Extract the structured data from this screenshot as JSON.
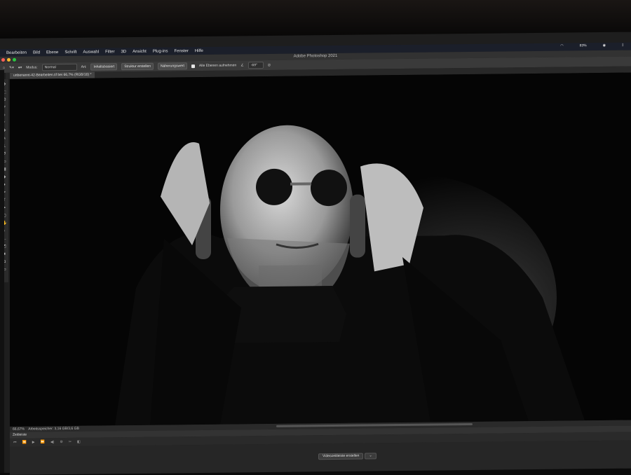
{
  "menubar": {
    "items": [
      "Bearbeiten",
      "Bild",
      "Ebene",
      "Schrift",
      "Auswahl",
      "Filter",
      "3D",
      "Ansicht",
      "Plug-ins",
      "Fenster",
      "Hilfe"
    ],
    "battery": "83%"
  },
  "window": {
    "title": "Adobe Photoshop 2021"
  },
  "options_bar": {
    "mode_label": "Modus:",
    "mode_value": "Normal",
    "type_label": "Art:",
    "btn_content_aware": "Inhaltsbasiert",
    "btn_create_texture": "Struktur erstellen",
    "btn_proximity": "Näherungswert",
    "sample_all_layers": "Alle Ebenen aufnehmen",
    "angle_value": "-69°"
  },
  "document": {
    "tab_title": "unbenannt-42-Bearbeiten.tif bei 66,7% (RGB/16) *"
  },
  "status": {
    "zoom": "66,67%",
    "scratch": "Arbeitsspeicher: 3,16 GB/3,6 GB"
  },
  "timeline": {
    "title": "Zeitleiste",
    "create_button": "Videozeitleiste erstellen"
  },
  "colors": {
    "accent": "#1b1f2a",
    "panel": "#2b2b2b",
    "canvas": "#050505"
  }
}
